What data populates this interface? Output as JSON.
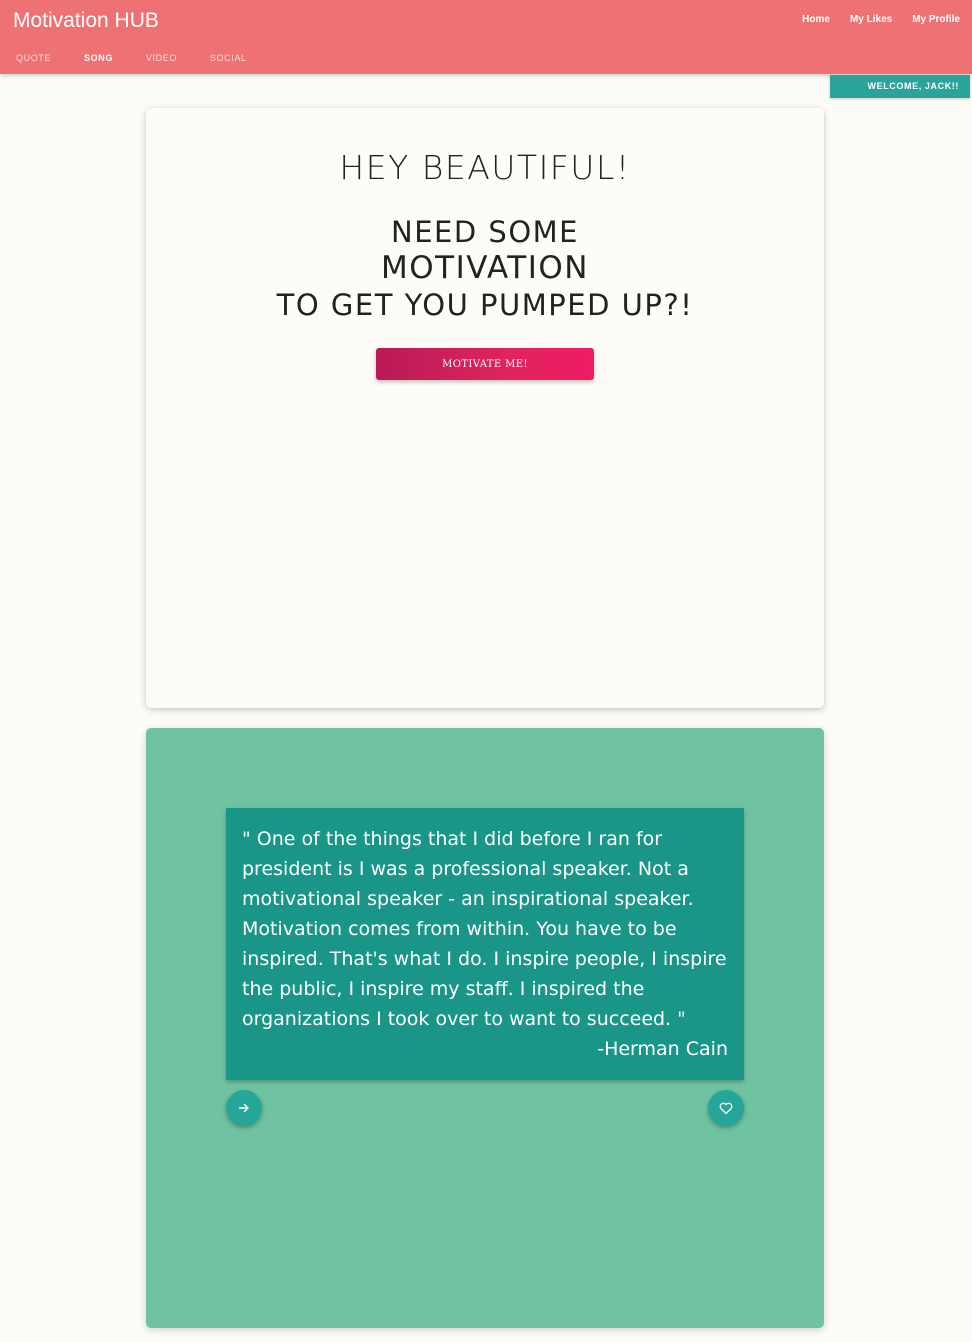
{
  "header": {
    "brand": "Motivation HUB",
    "nav": [
      "Home",
      "My Likes",
      "My Profile"
    ],
    "tabs": [
      {
        "label": "QUOTE",
        "active": false
      },
      {
        "label": "SONG",
        "active": true
      },
      {
        "label": "VIDEO",
        "active": false
      },
      {
        "label": "SOCIAL",
        "active": false
      }
    ],
    "bg_color": "#ee7274"
  },
  "welcome_badge": "WELCOME, JACK!!",
  "hero": {
    "title": "Hey beautiful!",
    "subtitle_line1": "Need some",
    "subtitle_line2": "motivation",
    "subtitle_line3": "to get you pumped up?!",
    "button_label": "Motivate me!"
  },
  "quote": {
    "text": "\" One of the things that I did before I ran for president is I was a professional speaker. Not a motivational speaker - an inspirational speaker. Motivation comes from within. You have to be inspired. That's what I do. I inspire people, I inspire the public, I inspire my staff. I inspired the organizations I took over to want to succeed. \"",
    "author": "-Herman Cain",
    "next_icon": "arrow-right-icon",
    "like_icon": "heart-icon",
    "section_color": "#6fc3a0",
    "box_color": "#1a9688"
  }
}
